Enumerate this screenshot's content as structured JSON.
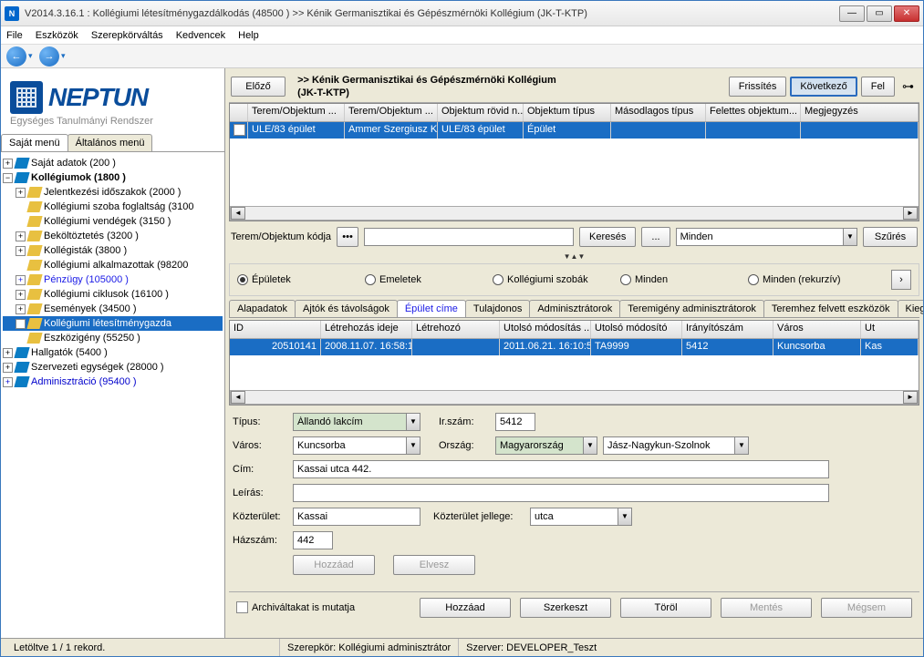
{
  "window": {
    "title": "V2014.3.16.1 : Kollégiumi létesítménygazdálkodás (48500  )  >> Kénik Germanisztikai és Gépészmérnöki Kollégium (JK-T-KTP)"
  },
  "menu": {
    "file": "File",
    "eszkozok": "Eszközök",
    "szerep": "Szerepkörváltás",
    "kedvencek": "Kedvencek",
    "help": "Help"
  },
  "logo": {
    "name": "NEPTUN",
    "subtitle": "Egységes Tanulmányi Rendszer"
  },
  "left_tabs": {
    "sajat": "Saját menü",
    "altalanos": "Általános menü"
  },
  "tree": {
    "n0": "Saját adatok (200  )",
    "n1": "Kollégiumok (1800  )",
    "n1_0": "Jelentkezési időszakok (2000  )",
    "n1_1": "Kollégiumi szoba foglaltság (3100",
    "n1_2": "Kollégiumi vendégek (3150  )",
    "n1_3": "Beköltöztetés (3200  )",
    "n1_4": "Kollégisták (3800  )",
    "n1_5": "Kollégiumi alkalmazottak (98200",
    "n1_6": "Pénzügy (105000  )",
    "n1_7": "Kollégiumi ciklusok (16100  )",
    "n1_8": "Események (34500  )",
    "n1_9": "Kollégiumi létesítménygazda",
    "n1_10": "Eszközigény (55250  )",
    "n2": "Hallgatók (5400  )",
    "n3": "Szervezeti egységek (28000  )",
    "n4": "Adminisztráció (95400  )"
  },
  "toolbar": {
    "elozo": "Előző",
    "crumb1": ">> Kénik Germanisztikai és Gépészmérnöki Kollégium",
    "crumb2": "(JK-T-KTP)",
    "frissites": "Frissítés",
    "kovetkezo": "Következő",
    "fel": "Fel"
  },
  "grid1": {
    "headers": [
      "",
      "Terem/Objektum ...",
      "Terem/Objektum ...",
      "Objektum rövid n...",
      "Objektum típus",
      "Másodlagos típus",
      "Felettes objektum...",
      "Megjegyzés"
    ],
    "row": [
      "",
      "ULE/83 épület",
      "Ammer Szergiusz Ko",
      "ULE/83 épület",
      "Épület",
      "",
      "",
      ""
    ]
  },
  "search": {
    "label": "Terem/Objektum kódja",
    "btn_search": "Keresés",
    "btn_dots": "...",
    "filter_all": "Minden",
    "btn_filter": "Szűrés"
  },
  "radios": {
    "r1": "Épületek",
    "r2": "Emeletek",
    "r3": "Kollégiumi szobák",
    "r4": "Minden",
    "r5": "Minden (rekurzív)"
  },
  "subtabs": {
    "t1": "Alapadatok",
    "t2": "Ajtók és távolságok",
    "t3": "Épület címe",
    "t4": "Tulajdonos",
    "t5": "Adminisztrátorok",
    "t6": "Teremigény adminisztrátorok",
    "t7": "Teremhez felvett eszközök",
    "t8": "Kiegé"
  },
  "grid2": {
    "headers": [
      "ID",
      "Létrehozás ideje",
      "Létrehozó",
      "Utolsó módosítás ...",
      "Utolsó módosító",
      "Irányítószám",
      "Város",
      "Ut"
    ],
    "row": [
      "20510141",
      "2008.11.07. 16:58:1",
      "",
      "2011.06.21. 16:10:5",
      "TA9999",
      "5412",
      "Kuncsorba",
      "Kas"
    ]
  },
  "form": {
    "tipus_l": "Típus:",
    "tipus_v": "Állandó lakcím",
    "irszam_l": "Ir.szám:",
    "irszam_v": "5412",
    "varos_l": "Város:",
    "varos_v": "Kuncsorba",
    "orszag_l": "Ország:",
    "orszag_v": "Magyarország",
    "megye_v": "Jász-Nagykun-Szolnok",
    "cim_l": "Cím:",
    "cim_v": "Kassai utca 442.",
    "leiras_l": "Leírás:",
    "kozterulet_l": "Közterület:",
    "kozterulet_v": "Kassai",
    "kozjelleg_l": "Közterület jellege:",
    "kozjelleg_v": "utca",
    "hazszam_l": "Házszám:",
    "hazszam_v": "442",
    "btn_hozzaad_mini": "Hozzáad",
    "btn_elvesz": "Elvesz"
  },
  "bottom": {
    "archive": "Archiváltakat is mutatja",
    "hozzaad": "Hozzáad",
    "szerkeszt": "Szerkeszt",
    "torol": "Töröl",
    "mentes": "Mentés",
    "megsem": "Mégsem"
  },
  "status": {
    "left": "Letöltve 1 / 1 rekord.",
    "role": "Szerepkör: Kollégiumi adminisztrátor",
    "server": "Szerver: DEVELOPER_Teszt"
  }
}
